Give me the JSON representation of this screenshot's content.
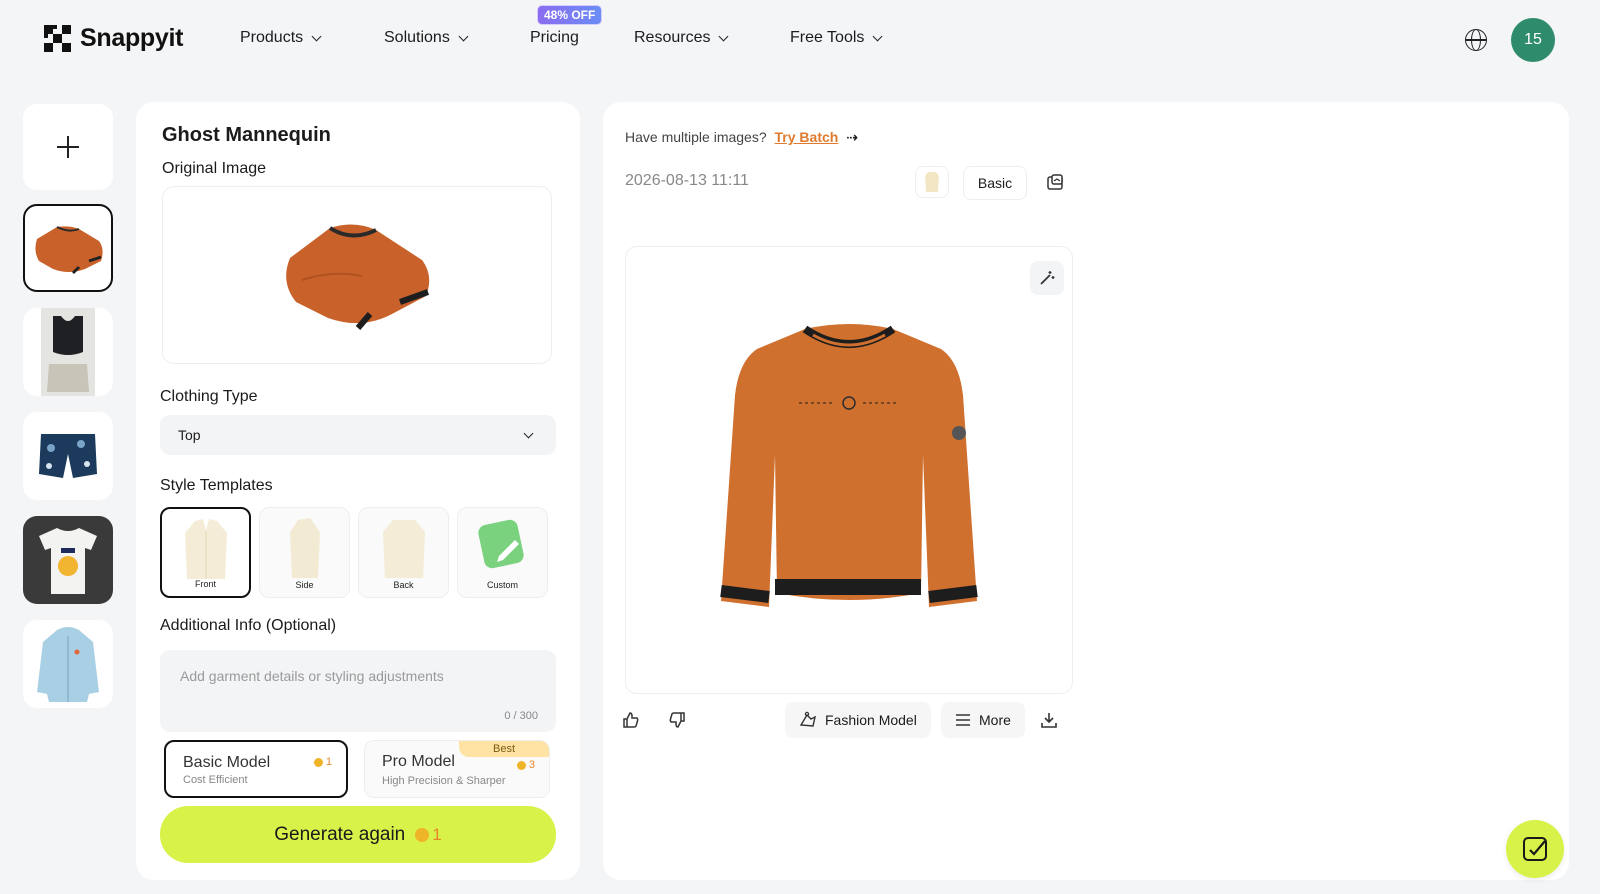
{
  "header": {
    "brand": "Snappyit",
    "nav": [
      {
        "label": "Products",
        "has_menu": true
      },
      {
        "label": "Solutions",
        "has_menu": true
      },
      {
        "label": "Pricing",
        "has_menu": false
      },
      {
        "label": "Resources",
        "has_menu": true
      },
      {
        "label": "Free Tools",
        "has_menu": true
      }
    ],
    "pricing_badge": "48% OFF",
    "avatar_text": "15",
    "colors": {
      "avatar": "#2e8c6c",
      "badge": "#7b7cf2"
    }
  },
  "rail": {
    "add_icon": "plus-icon",
    "thumbnails": [
      {
        "name": "orange-sweatshirt",
        "active": true
      },
      {
        "name": "black-tank-top-with-shorts",
        "active": false
      },
      {
        "name": "floral-navy-shorts",
        "active": false
      },
      {
        "name": "white-jersey-tshirt",
        "active": false
      },
      {
        "name": "light-blue-hoodie",
        "active": false
      }
    ]
  },
  "left_panel": {
    "title": "Ghost Mannequin",
    "original_image_label": "Original Image",
    "clothing_type_label": "Clothing Type",
    "clothing_type_value": "Top",
    "style_templates_label": "Style Templates",
    "templates": [
      {
        "label": "Front",
        "active": true
      },
      {
        "label": "Side",
        "active": false
      },
      {
        "label": "Back",
        "active": false
      },
      {
        "label": "Custom",
        "active": false
      }
    ],
    "additional_info_label": "Additional Info (Optional)",
    "additional_info_placeholder": "Add garment details or styling adjustments",
    "char_counter": "0 / 300",
    "models": {
      "basic": {
        "name": "Basic Model",
        "subtitle": "Cost Efficient",
        "cost": "1"
      },
      "pro": {
        "name": "Pro Model",
        "subtitle": "High Precision & Sharper",
        "cost": "3",
        "tag": "Best"
      }
    },
    "generate_label": "Generate again",
    "generate_cost": "1",
    "colors": {
      "accent": "#d9f24a",
      "coin": "#f0b428"
    }
  },
  "right_panel": {
    "batch_prompt": "Have multiple images?",
    "batch_link": "Try Batch",
    "timestamp": "2026-08-13 11:11",
    "quality": "Basic",
    "actions": {
      "fashion_model": "Fashion Model",
      "more": "More"
    }
  }
}
